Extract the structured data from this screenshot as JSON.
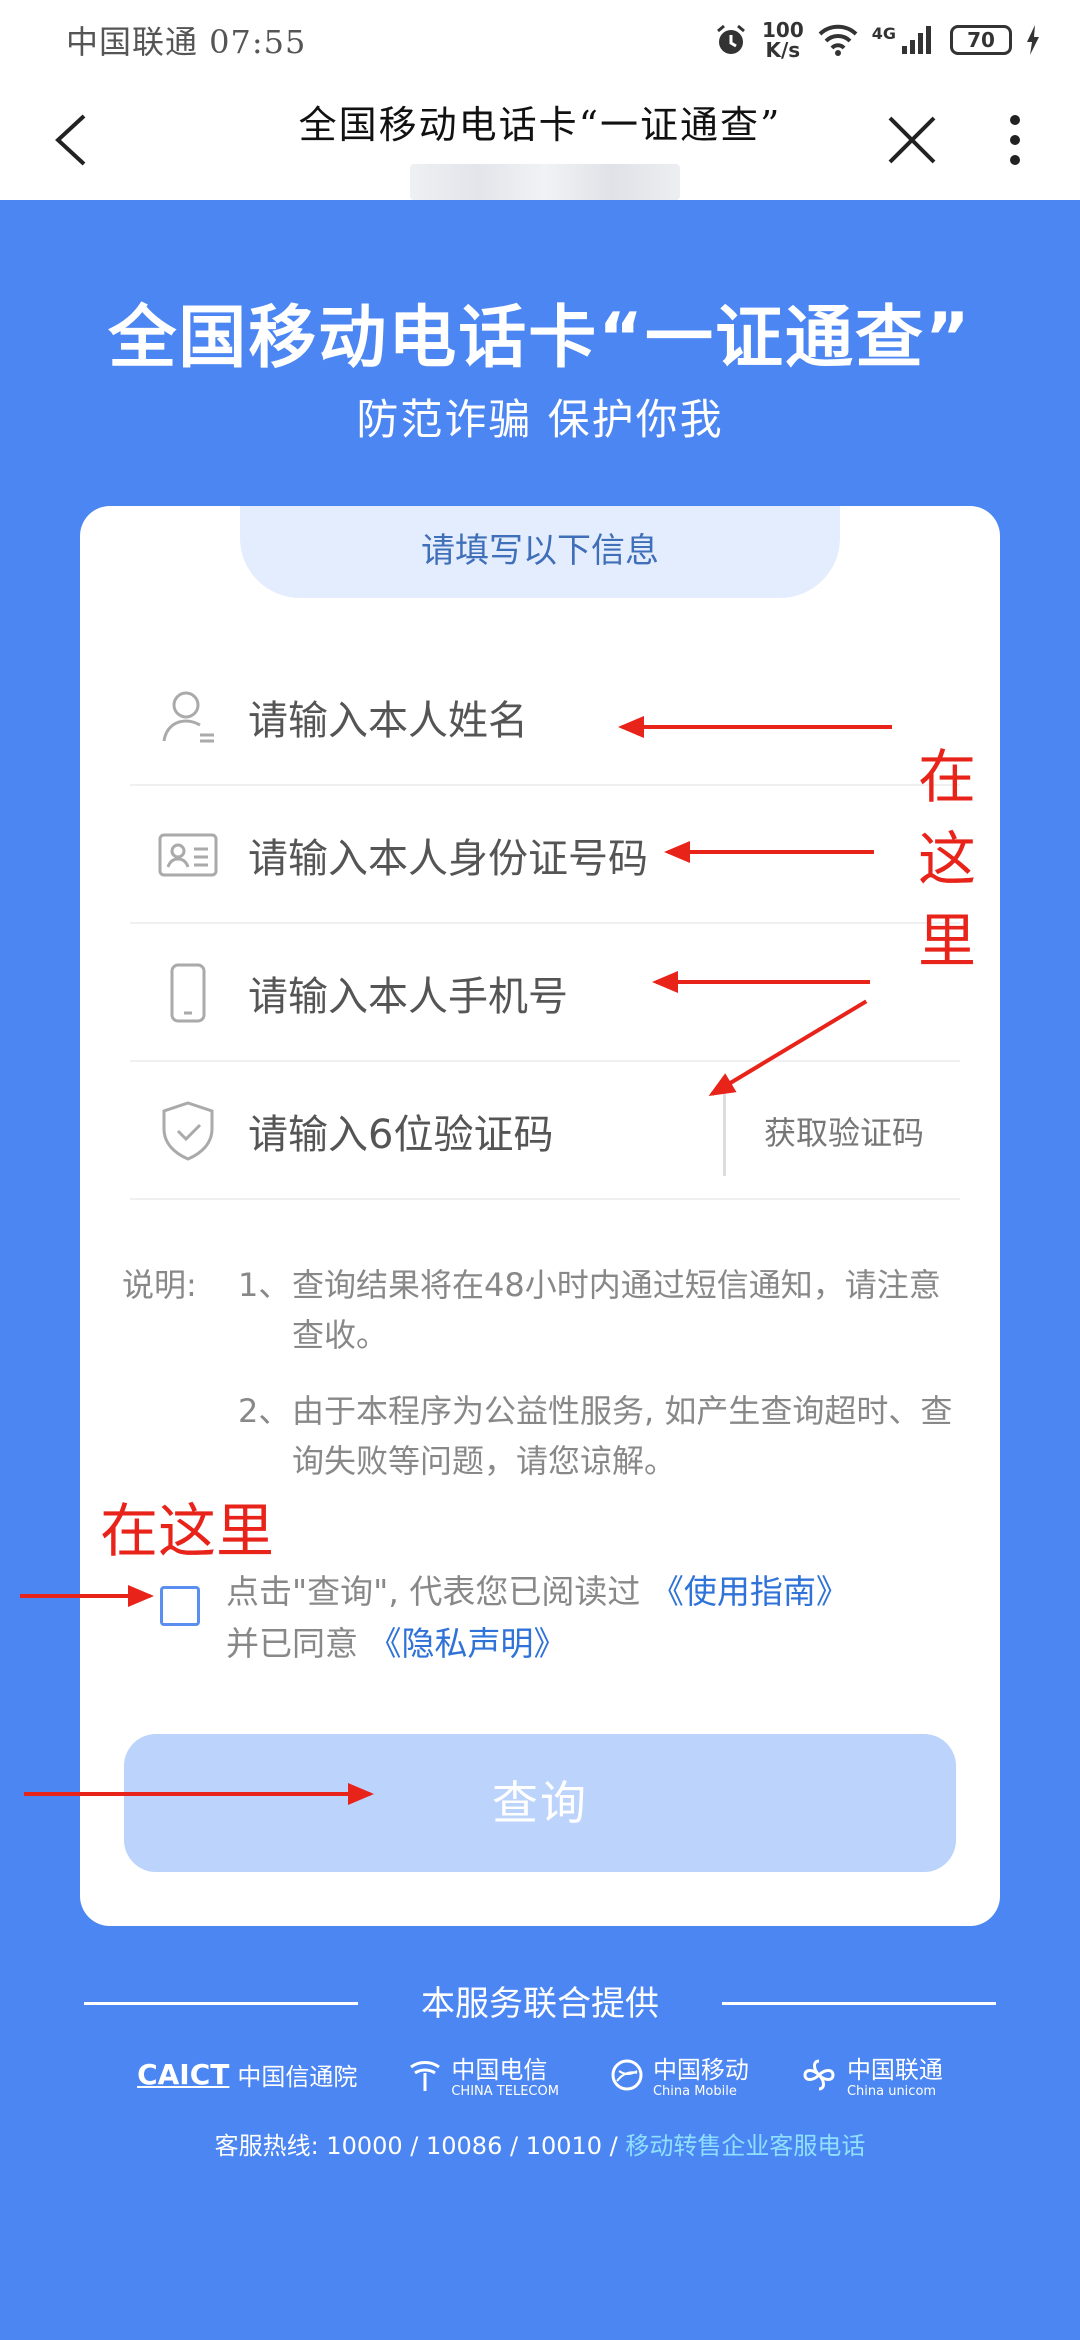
{
  "status": {
    "carrier_time": "中国联通 07:55",
    "speed_top": "100",
    "speed_unit": "K/s",
    "network": "4G",
    "battery": "70"
  },
  "nav": {
    "title": "全国移动电话卡“一证通查”"
  },
  "hero": {
    "title": "全国移动电话卡“一证通查”",
    "subtitle": "防范诈骗 保护你我"
  },
  "form": {
    "tab_label": "请填写以下信息",
    "name_placeholder": "请输入本人姓名",
    "id_placeholder": "请输入本人身份证号码",
    "phone_placeholder": "请输入本人手机号",
    "code_placeholder": "请输入6位验证码",
    "get_code_label": "获取验证码"
  },
  "notes": {
    "label": "说明:",
    "items": [
      {
        "num": "1、",
        "text": "查询结果将在48小时内通过短信通知，请注意查收。"
      },
      {
        "num": "2、",
        "text": "由于本程序为公益性服务, 如产生查询超时、查询失败等问题，请您谅解。"
      }
    ]
  },
  "agreement": {
    "prefix": "点击\"查询\", 代表您已阅读过",
    "guide_link": "《使用指南》",
    "middle": "并已同意",
    "privacy_link": "《隐私声明》",
    "checked": false
  },
  "submit_label": "查询",
  "footer": {
    "provided_by": "本服务联合提供",
    "logos": [
      {
        "mark": "CAICT",
        "name": "中国信通院"
      },
      {
        "name": "中国电信",
        "sub": "CHINA TELECOM"
      },
      {
        "name": "中国移动",
        "sub": "China Mobile"
      },
      {
        "name": "中国联通",
        "sub": "China unicom"
      }
    ],
    "hotline_prefix": "客服热线: 10000 / 10086 / 10010 / ",
    "hotline_link": "移动转售企业客服电话"
  },
  "annotations": {
    "here_vertical": "在这里",
    "here_horizontal": "在这里"
  },
  "colors": {
    "primary": "#4c86f2",
    "link": "#2f72d8",
    "button": "#bcd3fb",
    "annotation": "#e8231a"
  }
}
